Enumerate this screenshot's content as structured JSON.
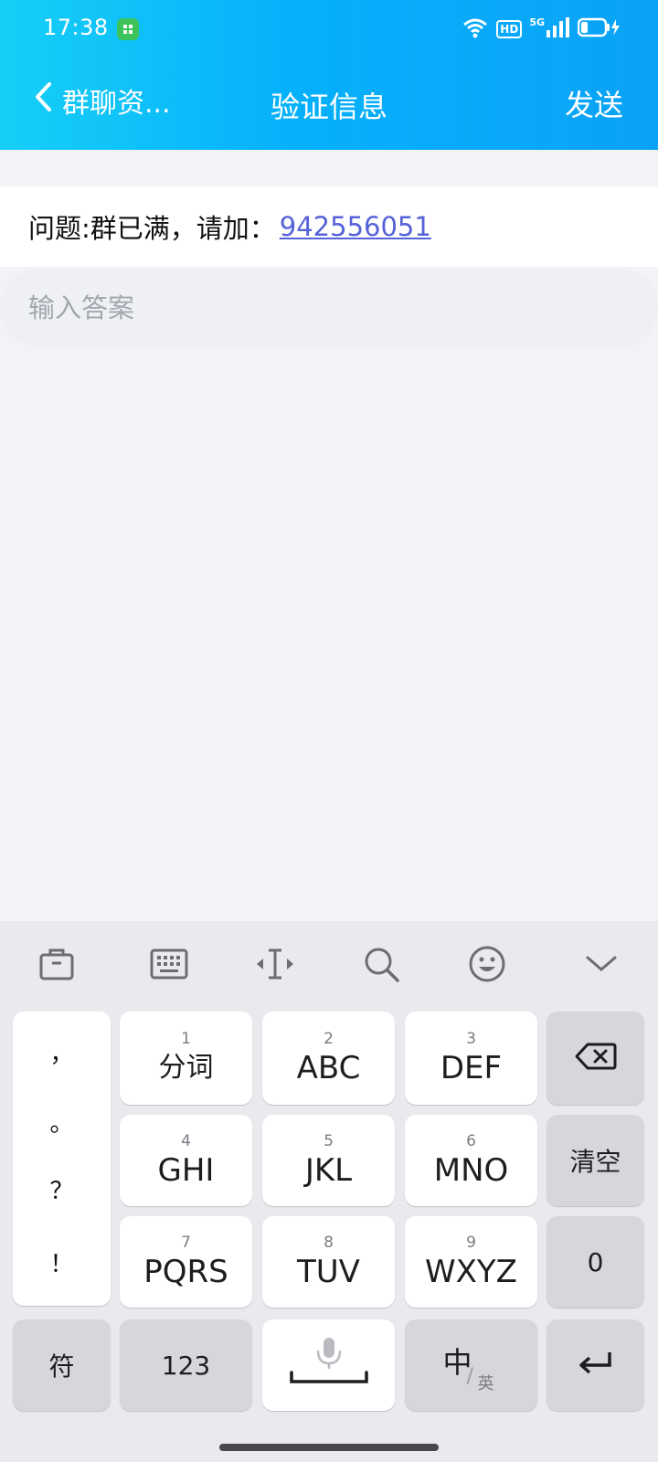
{
  "status_bar": {
    "time": "17:38",
    "network": "5G",
    "hd": "HD"
  },
  "header": {
    "back_label": "群聊资...",
    "title": "验证信息",
    "send_label": "发送"
  },
  "question": {
    "text": "问题:群已满，请加：",
    "link": "942556051"
  },
  "answer": {
    "placeholder": "输入答案",
    "value": ""
  },
  "keyboard": {
    "toolbar": [
      "toolbox-icon",
      "keyboard-icon",
      "cursor-icon",
      "search-icon",
      "emoji-icon",
      "collapse-icon"
    ],
    "punctuation": [
      "，",
      "。",
      "？",
      "！"
    ],
    "keys": {
      "k1": {
        "num": "1",
        "label": "分词"
      },
      "k2": {
        "num": "2",
        "label": "ABC"
      },
      "k3": {
        "num": "3",
        "label": "DEF"
      },
      "k4": {
        "num": "4",
        "label": "GHI"
      },
      "k5": {
        "num": "5",
        "label": "JKL"
      },
      "k6": {
        "num": "6",
        "label": "MNO"
      },
      "k7": {
        "num": "7",
        "label": "PQRS"
      },
      "k8": {
        "num": "8",
        "label": "TUV"
      },
      "k9": {
        "num": "9",
        "label": "WXYZ"
      }
    },
    "clear_label": "清空",
    "zero_label": "0",
    "symbol_label": "符",
    "num_label": "123",
    "lang_main": "中",
    "lang_sub": "英"
  },
  "colors": {
    "header_start": "#16cff7",
    "header_end": "#0ba2f6",
    "link": "#5662d8"
  }
}
